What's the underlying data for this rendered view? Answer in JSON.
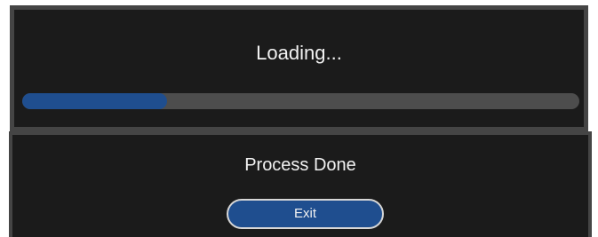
{
  "loading_panel": {
    "title": "Loading...",
    "progress": 0.26
  },
  "done_panel": {
    "title": "Process Done",
    "exit_label": "Exit"
  },
  "colors": {
    "panel_background": "#1b1b1b",
    "panel_border": "#454545",
    "progress_track": "#4d4d4d",
    "accent_blue": "#1f4e8f",
    "text": "#f2f2f2",
    "button_border": "#d6d6d6"
  }
}
